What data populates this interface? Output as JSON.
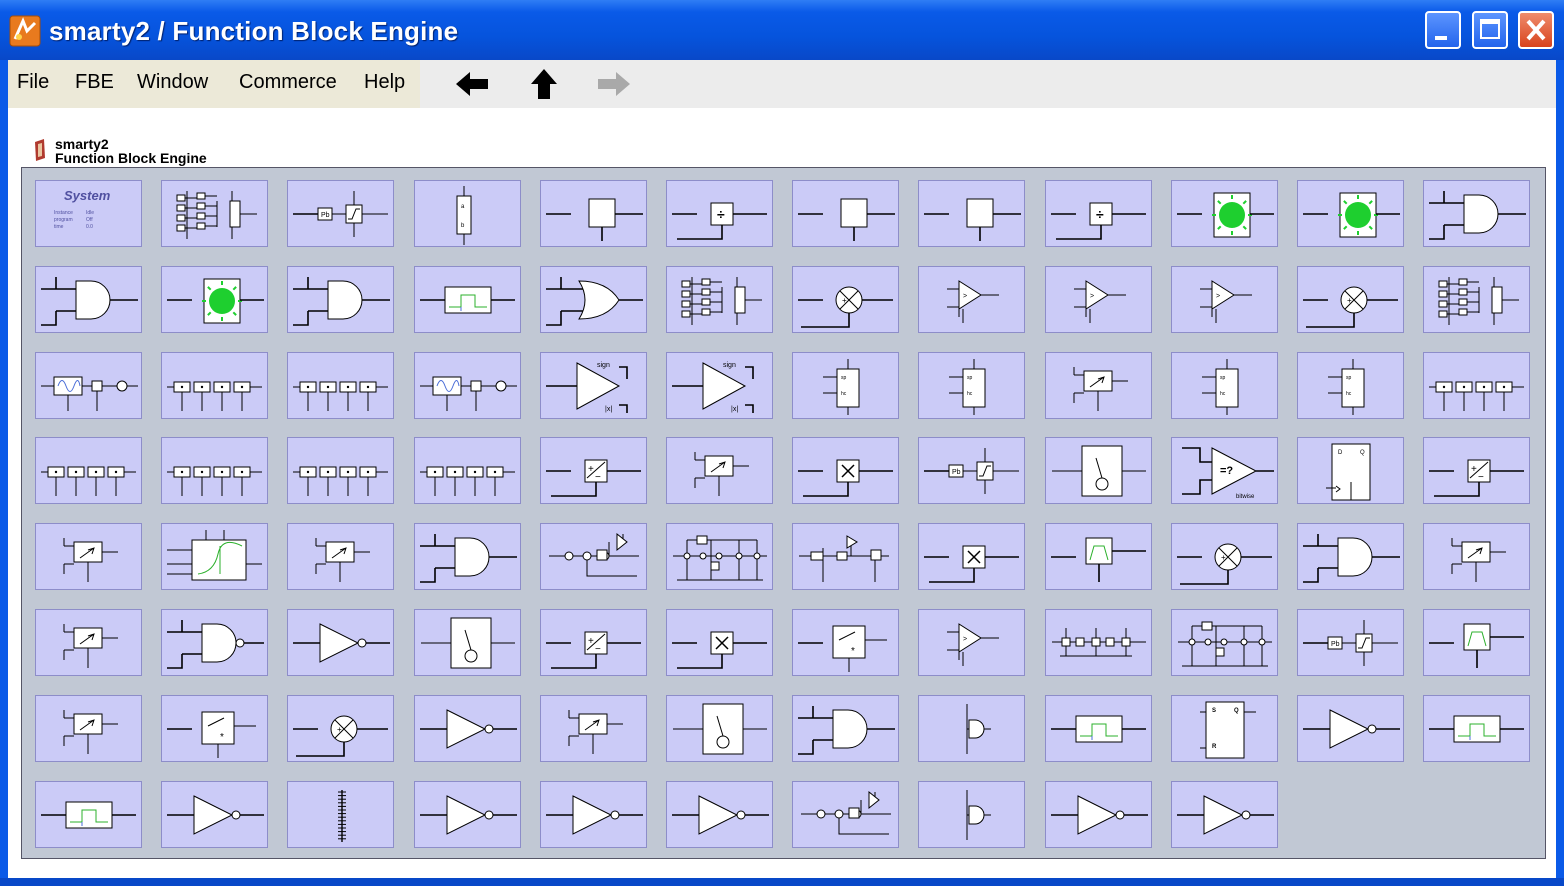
{
  "window": {
    "title": "smarty2 / Function Block Engine"
  },
  "menu": [
    "File",
    "FBE",
    "Window",
    "Commerce",
    "Help"
  ],
  "nav": {
    "back_icon": "arrow-left-icon",
    "up_icon": "arrow-up-icon",
    "forward_icon": "arrow-right-icon",
    "forward_enabled": false
  },
  "brand": {
    "line1": "smarty2",
    "line2": "Function Block Engine"
  },
  "system_block": {
    "title": "System",
    "rows": [
      [
        "Instance",
        "Idle"
      ],
      [
        "program",
        "Off"
      ],
      [
        "time",
        "0.0"
      ]
    ]
  },
  "colors": {
    "titlebar": "#0654dd",
    "panel": "#c1c8d4",
    "block": "#cbcbf7",
    "lamp": "#1ecf2f",
    "close": "#d8431d"
  },
  "grid": {
    "columns": 12
  },
  "blocks": [
    "system",
    "iogroup",
    "limit",
    "ratio",
    "process",
    "divide",
    "process",
    "process",
    "divide",
    "lamp",
    "lamp",
    "and",
    "and",
    "lamp",
    "and",
    "pulse",
    "or",
    "iogroup",
    "sum",
    "comparator",
    "comparator",
    "comparator",
    "sum",
    "iogroup",
    "modulate",
    "bits",
    "bits",
    "modulate",
    "amplifier",
    "amplifier",
    "split",
    "split",
    "mux",
    "split",
    "split",
    "bits",
    "bits",
    "bits",
    "bits",
    "bits",
    "addsub",
    "mux",
    "multiply",
    "limit",
    "gauge",
    "eqcompare",
    "dflipflop",
    "addsub",
    "mux",
    "curve",
    "mux",
    "and",
    "modchain",
    "network",
    "chain",
    "multiply",
    "bandpass",
    "sum",
    "and",
    "mux",
    "mux",
    "nand",
    "not",
    "gauge",
    "addsub",
    "multiply",
    "muxstar",
    "comparator",
    "bus",
    "network",
    "limit",
    "bandpass",
    "mux",
    "muxstar",
    "sum",
    "not",
    "mux",
    "gauge",
    "and",
    "delay",
    "pulse",
    "srlatch",
    "not",
    "pulse",
    "pulse",
    "not",
    "ruler",
    "not",
    "not",
    "not",
    "modchain",
    "delay",
    "not",
    "not"
  ]
}
